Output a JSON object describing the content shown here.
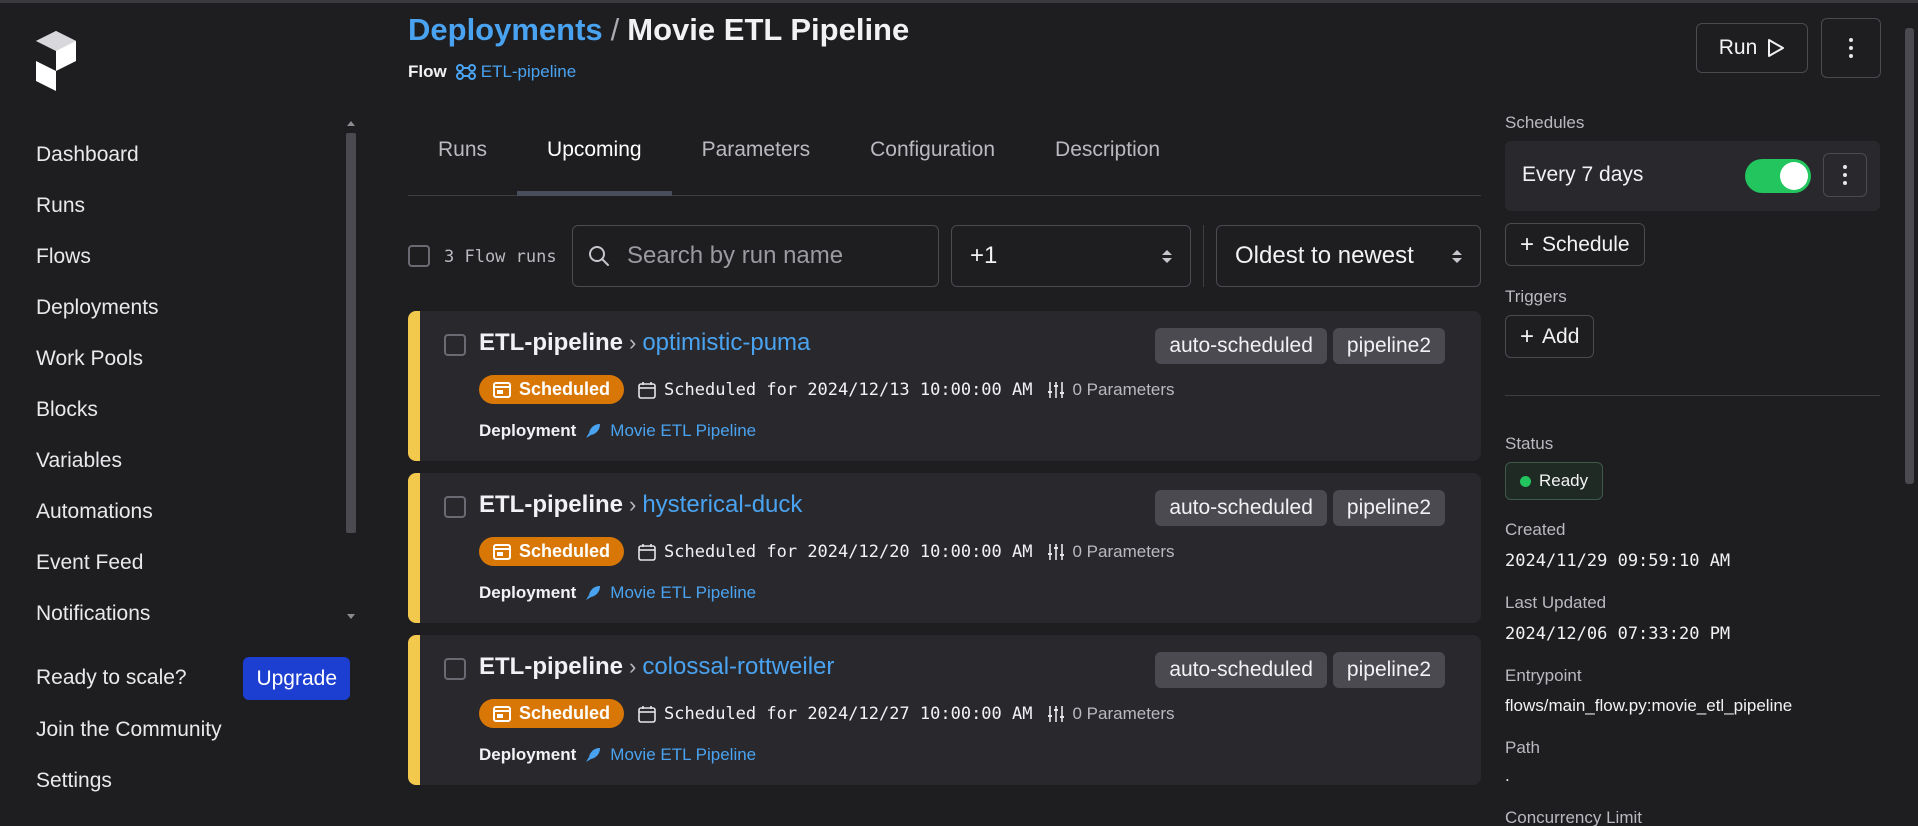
{
  "sidebar": {
    "nav": [
      {
        "label": "Dashboard"
      },
      {
        "label": "Runs"
      },
      {
        "label": "Flows"
      },
      {
        "label": "Deployments"
      },
      {
        "label": "Work Pools"
      },
      {
        "label": "Blocks"
      },
      {
        "label": "Variables"
      },
      {
        "label": "Automations"
      },
      {
        "label": "Event Feed"
      },
      {
        "label": "Notifications"
      }
    ],
    "scale_text": "Ready to scale?",
    "upgrade_label": "Upgrade",
    "community_label": "Join the Community",
    "settings_label": "Settings"
  },
  "header": {
    "breadcrumb_link": "Deployments",
    "breadcrumb_sep": "/",
    "title": "Movie ETL Pipeline",
    "flow_label": "Flow",
    "flow_link": "ETL-pipeline",
    "run_label": "Run"
  },
  "tabs": [
    {
      "label": "Runs",
      "active": false
    },
    {
      "label": "Upcoming",
      "active": true
    },
    {
      "label": "Parameters",
      "active": false
    },
    {
      "label": "Configuration",
      "active": false
    },
    {
      "label": "Description",
      "active": false
    }
  ],
  "toolbar": {
    "count_label": "3 Flow runs",
    "search_placeholder": "Search by run name",
    "filter_value": "+1",
    "sort_value": "Oldest to newest"
  },
  "runs": [
    {
      "flow": "ETL-pipeline",
      "name": "optimistic-puma",
      "tags": [
        "auto-scheduled",
        "pipeline2"
      ],
      "state": "Scheduled",
      "scheduled": "Scheduled for 2024/12/13 10:00:00 AM",
      "params": "0 Parameters",
      "deployment_label": "Deployment",
      "deployment": "Movie ETL Pipeline"
    },
    {
      "flow": "ETL-pipeline",
      "name": "hysterical-duck",
      "tags": [
        "auto-scheduled",
        "pipeline2"
      ],
      "state": "Scheduled",
      "scheduled": "Scheduled for 2024/12/20 10:00:00 AM",
      "params": "0 Parameters",
      "deployment_label": "Deployment",
      "deployment": "Movie ETL Pipeline"
    },
    {
      "flow": "ETL-pipeline",
      "name": "colossal-rottweiler",
      "tags": [
        "auto-scheduled",
        "pipeline2"
      ],
      "state": "Scheduled",
      "scheduled": "Scheduled for 2024/12/27 10:00:00 AM",
      "params": "0 Parameters",
      "deployment_label": "Deployment",
      "deployment": "Movie ETL Pipeline"
    }
  ],
  "right_panel": {
    "schedules_label": "Schedules",
    "schedule_text": "Every 7 days",
    "schedule_enabled": true,
    "add_schedule_label": "Schedule",
    "triggers_label": "Triggers",
    "add_trigger_label": "Add",
    "status_label": "Status",
    "status_value": "Ready",
    "created_label": "Created",
    "created_value": "2024/11/29 09:59:10 AM",
    "updated_label": "Last Updated",
    "updated_value": "2024/12/06 07:33:20 PM",
    "entrypoint_label": "Entrypoint",
    "entrypoint_value": "flows/main_flow.py:movie_etl_pipeline",
    "path_label": "Path",
    "path_value": ".",
    "concurrency_label": "Concurrency Limit"
  },
  "colors": {
    "accent_link": "#4aa3f0",
    "scheduled_badge": "#d97706",
    "card_stripe": "#f2c94c",
    "toggle_on": "#22c55e",
    "upgrade_button": "#1d3fd1"
  }
}
